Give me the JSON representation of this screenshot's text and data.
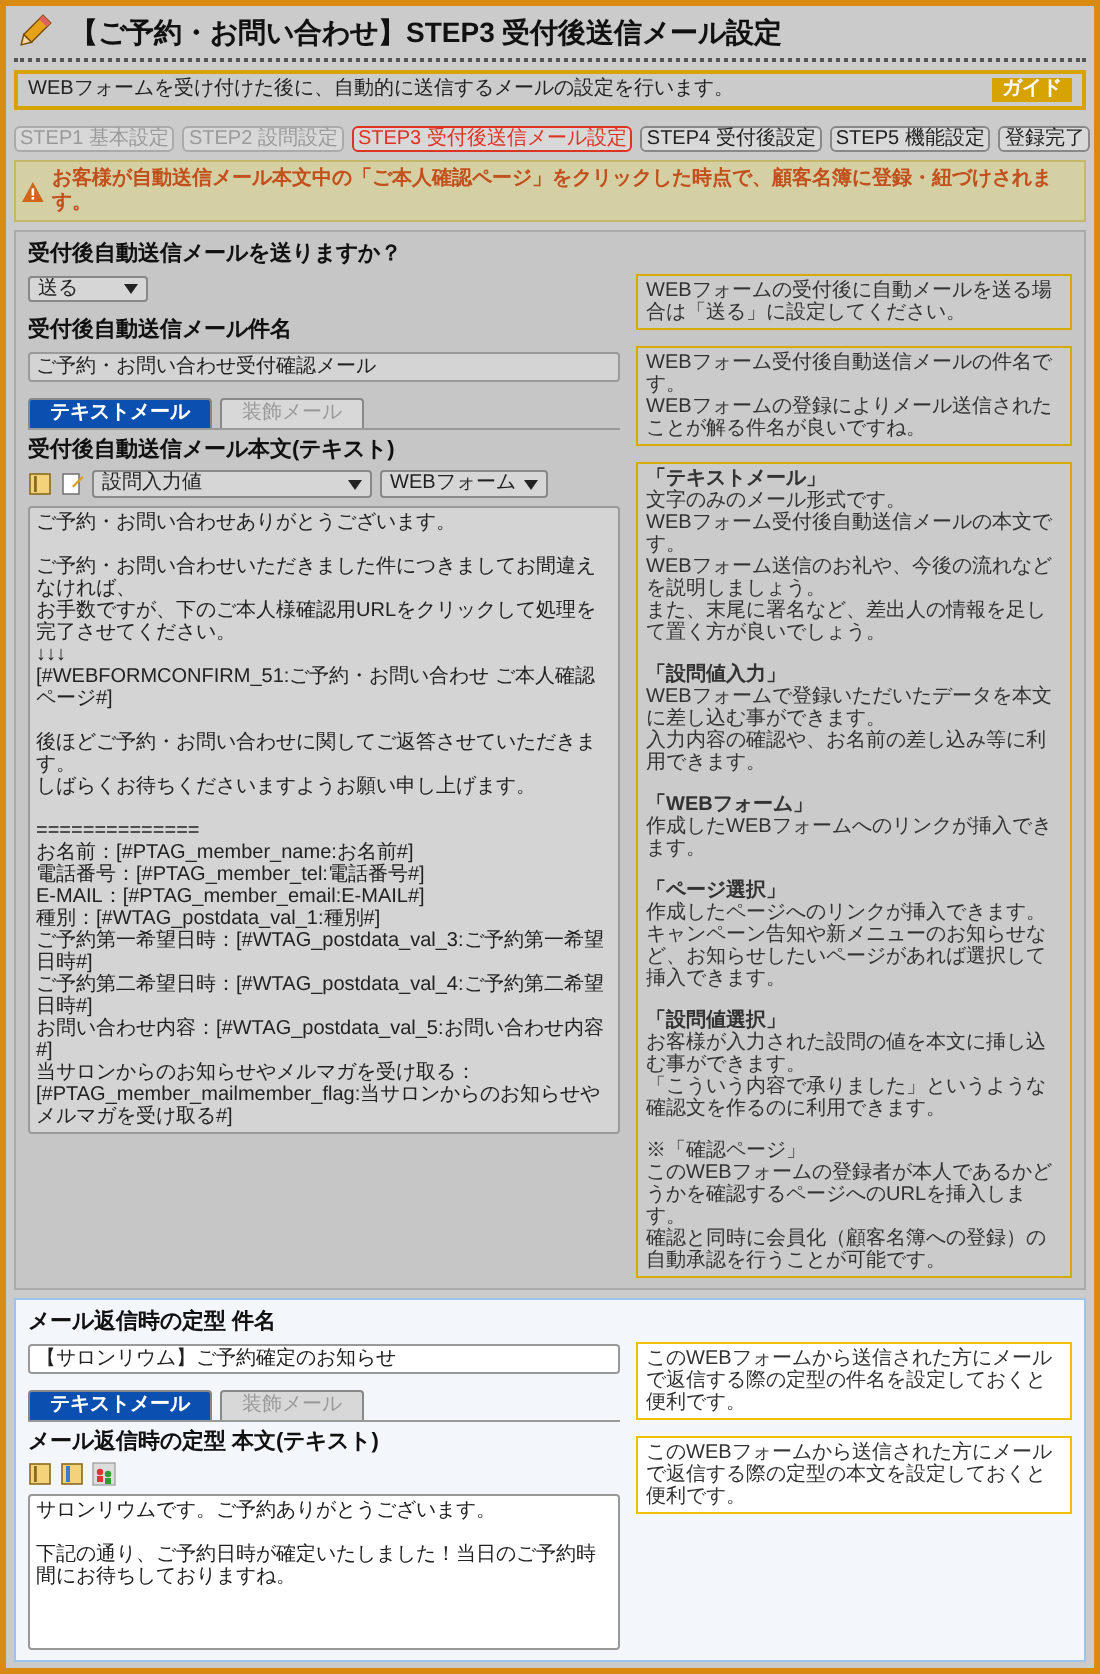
{
  "page_title": "【ご予約・お問い合わせ】STEP3 受付後送信メール設定",
  "guide": {
    "badge": "ガイド",
    "text": "WEBフォームを受け付けた後に、自動的に送信するメールの設定を行います。"
  },
  "steps": [
    {
      "label": "STEP1 基本設定",
      "completed": true,
      "selected": false
    },
    {
      "label": "STEP2 設問設定",
      "completed": true,
      "selected": false
    },
    {
      "label": "STEP3 受付後送信メール設定",
      "completed": false,
      "selected": true
    },
    {
      "label": "STEP4 受付後設定",
      "completed": false,
      "selected": false
    },
    {
      "label": "STEP5 機能設定",
      "completed": false,
      "selected": false
    },
    {
      "label": "登録完了",
      "completed": false,
      "selected": false
    }
  ],
  "warning": "お客様が自動送信メール本文中の「ご本人確認ページ」をクリックした時点で、顧客名簿に登録・紐づけされます。",
  "auto_reply": {
    "send_question": "受付後自動送信メールを送りますか？",
    "send_value": "送る",
    "send_hint": [
      "WEBフォームの受付後に自動メールを送る場合は「送る」に設定してください。"
    ],
    "subject_label": "受付後自動送信メール件名",
    "subject_value": "ご予約・お問い合わせ受付確認メール",
    "subject_hint": [
      "WEBフォーム受付後自動送信メールの件名です。",
      "WEBフォームの登録によりメール送信されたことが解る件名が良いですね。"
    ],
    "tabs": [
      {
        "label": "テキストメール",
        "selected": true
      },
      {
        "label": "装飾メール",
        "selected": false
      }
    ],
    "body_label": "受付後自動送信メール本文(テキスト)",
    "insert_select": "設問入力値",
    "form_select": "WEBフォーム",
    "body": [
      [
        "ご予約・お問い合わせありがとうございます。"
      ],
      [
        "ご予約・お問い合わせいただきました件につきましてお間違えなければ、",
        "お手数ですが、下のご本人様確認用URLをクリックして処理を完了させてください。",
        "↓↓↓",
        "[#WEBFORMCONFIRM_51:ご予約・お問い合わせ ご本人確認ページ#]"
      ],
      [
        "後ほどご予約・お問い合わせに関してご返答させていただきます。",
        "しばらくお待ちくださいますようお願い申し上げます。"
      ],
      [
        "==============",
        "お名前：[#PTAG_member_name:お名前#]",
        "電話番号：[#PTAG_member_tel:電話番号#]",
        "E-MAIL：[#PTAG_member_email:E-MAIL#]",
        "種別：[#WTAG_postdata_val_1:種別#]",
        "ご予約第一希望日時：[#WTAG_postdata_val_3:ご予約第一希望日時#]",
        "ご予約第二希望日時：[#WTAG_postdata_val_4:ご予約第二希望日時#]",
        "お問い合わせ内容：[#WTAG_postdata_val_5:お問い合わせ内容#]",
        "当サロンからのお知らせやメルマガを受け取る：[#PTAG_member_mailmember_flag:当サロンからのお知らせやメルマガを受け取る#]"
      ]
    ],
    "body_hint": [
      {
        "heading": "「テキストメール」",
        "bold": true,
        "lines": [
          "文字のみのメール形式です。",
          "WEBフォーム受付後自動送信メールの本文です。",
          "WEBフォーム送信のお礼や、今後の流れなどを説明しましょう。",
          "また、末尾に署名など、差出人の情報を足して置く方が良いでしょう。"
        ]
      },
      {
        "heading": "「設問値入力」",
        "bold": true,
        "lines": [
          "WEBフォームで登録いただいたデータを本文に差し込む事ができます。",
          "入力内容の確認や、お名前の差し込み等に利用できます。"
        ]
      },
      {
        "heading": "「WEBフォーム」",
        "bold": true,
        "lines": [
          "作成したWEBフォームへのリンクが挿入できます。"
        ]
      },
      {
        "heading": "「ページ選択」",
        "bold": true,
        "lines": [
          "作成したページへのリンクが挿入できます。",
          "キャンペーン告知や新メニューのお知らせなど、お知らせしたいページがあれば選択して挿入できます。"
        ]
      },
      {
        "heading": "「設問値選択」",
        "bold": true,
        "lines": [
          "お客様が入力された設問の値を本文に挿し込む事ができます。",
          "「こういう内容で承りました」というような確認文を作るのに利用できます。"
        ]
      },
      {
        "heading": "※「確認ページ」",
        "bold": false,
        "lines": [
          "このWEBフォームの登録者が本人であるかどうかを確認するページへのURLを挿入します。",
          "確認と同時に会員化（顧客名簿への登録）の自動承認を行うことが可能です。"
        ]
      }
    ]
  },
  "template_reply": {
    "subject_label": "メール返信時の定型 件名",
    "subject_value": "【サロンリウム】ご予約確定のお知らせ",
    "subject_hint": [
      "このWEBフォームから送信された方にメールで返信する際の定型の件名を設定しておくと便利です。"
    ],
    "tabs": [
      {
        "label": "テキストメール",
        "selected": true
      },
      {
        "label": "装飾メール",
        "selected": false
      }
    ],
    "body_label": "メール返信時の定型 本文(テキスト)",
    "body": [
      [
        "サロンリウムです。ご予約ありがとうございます。"
      ],
      [
        "下記の通り、ご予約日時が確定いたしました！当日のご予約時間にお待ちしておりますね。"
      ]
    ],
    "body_hint": [
      "このWEBフォームから送信された方にメールで返信する際の定型の本文を設定しておくと便利です。"
    ]
  }
}
